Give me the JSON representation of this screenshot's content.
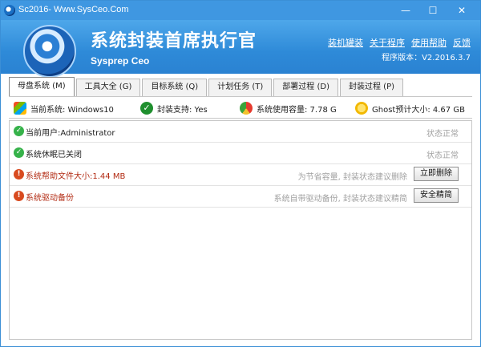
{
  "window": {
    "title": "Sc2016- Www.SysCeo.Com",
    "controls": {
      "minimize": "—",
      "maximize": "☐",
      "close": "✕"
    }
  },
  "header": {
    "title": "系统封装首席执行官",
    "subtitle": "Sysprep Ceo",
    "links": [
      "装机罐装",
      "关于程序",
      "使用帮助",
      "反馈"
    ],
    "version": "程序版本：V2.2016.3.7",
    "colors": {
      "accent": "#3f97e1"
    }
  },
  "tabs": [
    {
      "label": "母盘系统 (M)",
      "active": true
    },
    {
      "label": "工具大全 (G)",
      "active": false
    },
    {
      "label": "目标系统 (Q)",
      "active": false
    },
    {
      "label": "计划任务 (T)",
      "active": false
    },
    {
      "label": "部署过程 (D)",
      "active": false
    },
    {
      "label": "封装过程 (P)",
      "active": false
    }
  ],
  "info": {
    "os": {
      "icon": "windows-logo-icon",
      "text": "当前系统: Windows10"
    },
    "support": {
      "icon": "check-circle-icon",
      "text": "封装支持: Yes"
    },
    "disk": {
      "icon": "disk-usage-icon",
      "text": "系统使用容量: 7.78 G"
    },
    "ghost": {
      "icon": "ghost-icon",
      "text": "Ghost预计大小: 4.67 GB"
    }
  },
  "rows": [
    {
      "status_icon": "ok",
      "label": "当前用户:Administrator",
      "note": "",
      "status": "状态正常",
      "button": ""
    },
    {
      "status_icon": "ok",
      "label": "系统休眠已关闭",
      "note": "",
      "status": "状态正常",
      "button": ""
    },
    {
      "status_icon": "warn",
      "label": "系统帮助文件大小:1.44 MB",
      "note": "为节省容量, 封装状态建议删除",
      "status": "",
      "button": "立即删除"
    },
    {
      "status_icon": "warn",
      "label": "系统驱动备份",
      "note": "系统自带驱动备份, 封装状态建议精简",
      "status": "",
      "button": "安全精简"
    }
  ]
}
